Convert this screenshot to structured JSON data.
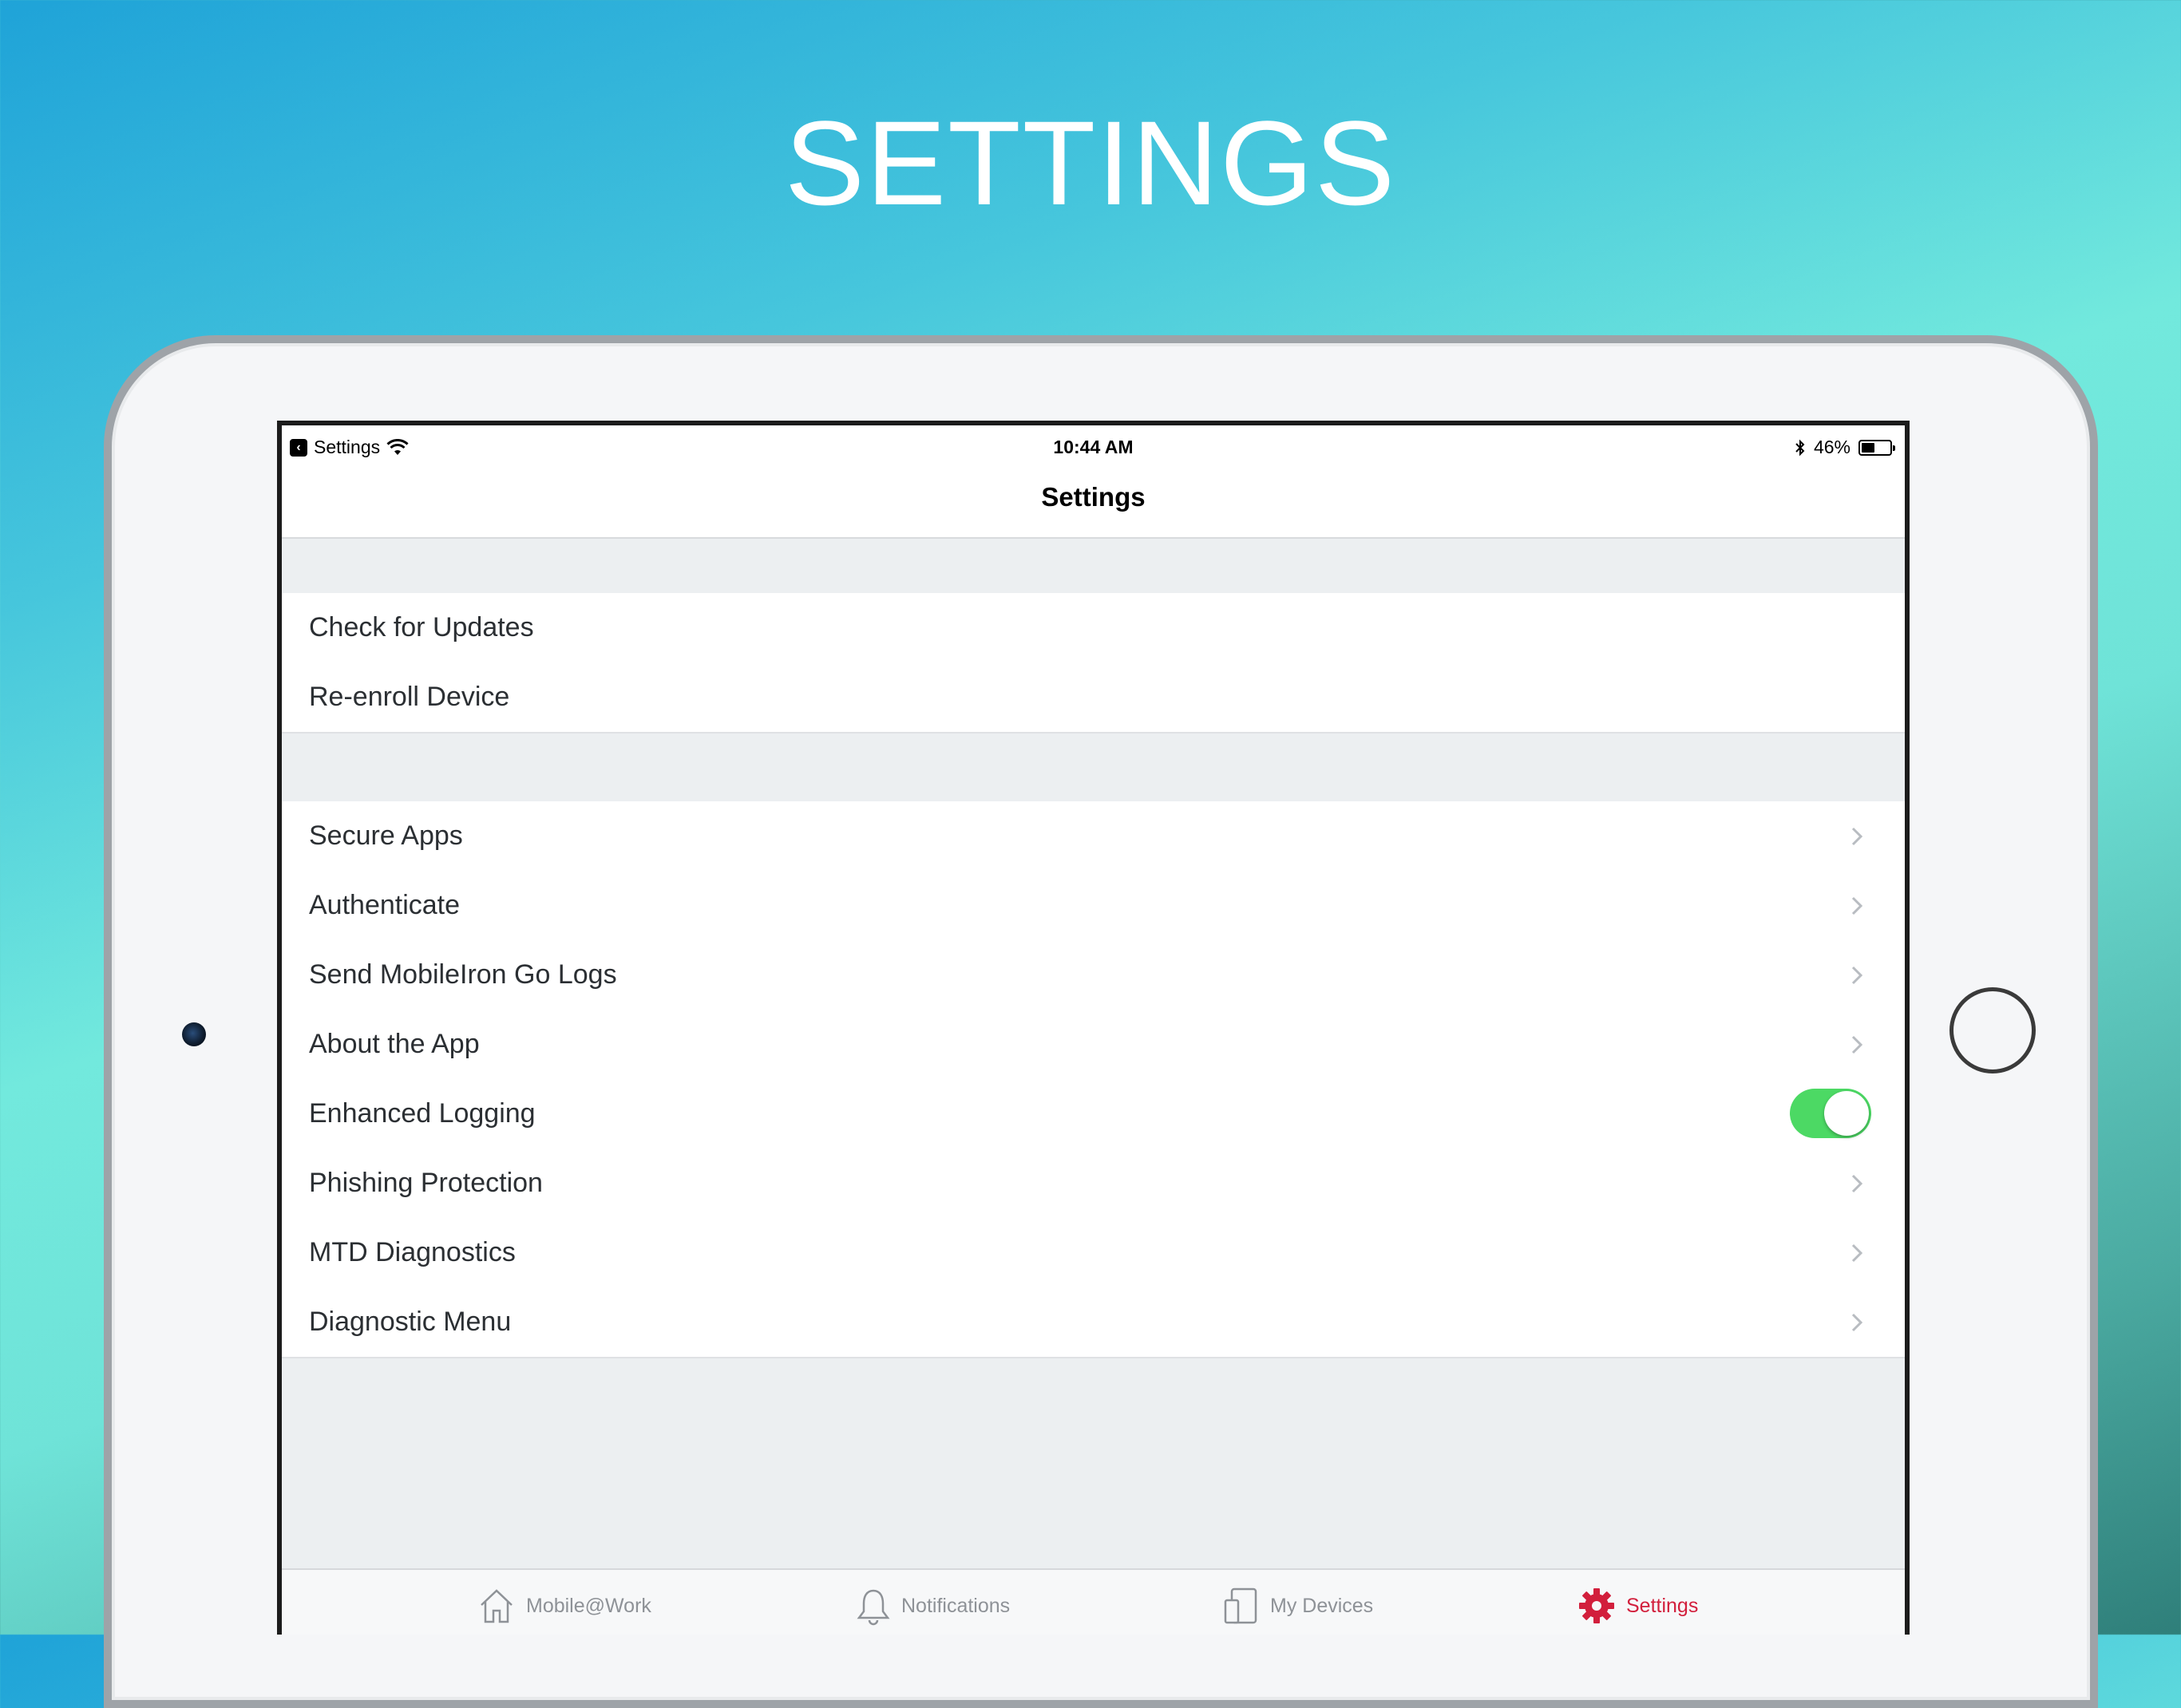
{
  "headline": "SETTINGS",
  "statusbar": {
    "back_app": "Settings",
    "time": "10:44 AM",
    "battery": "46%",
    "battery_level": 0.46,
    "wifi_icon": "wifi-icon",
    "bluetooth_icon": "bluetooth-icon"
  },
  "navbar": {
    "title": "Settings"
  },
  "sections": [
    {
      "rows": [
        {
          "label": "Check for Updates"
        },
        {
          "label": "Re-enroll Device"
        }
      ]
    },
    {
      "rows": [
        {
          "label": "Secure Apps",
          "accessory": "chevron-right-icon"
        },
        {
          "label": "Authenticate",
          "accessory": "chevron-right-icon"
        },
        {
          "label": "Send MobileIron Go Logs",
          "accessory": "chevron-right-icon"
        },
        {
          "label": "About the App",
          "accessory": "chevron-right-icon"
        },
        {
          "label": "Enhanced Logging",
          "accessory": "toggle",
          "toggle_on": true
        },
        {
          "label": "Phishing Protection",
          "accessory": "chevron-right-icon"
        },
        {
          "label": "MTD Diagnostics",
          "accessory": "chevron-right-icon"
        },
        {
          "label": "Diagnostic Menu",
          "accessory": "chevron-right-icon"
        }
      ]
    }
  ],
  "tabbar": {
    "tabs": [
      {
        "label": "Mobile@Work",
        "icon": "home-icon",
        "active": false
      },
      {
        "label": "Notifications",
        "icon": "bell-icon",
        "active": false
      },
      {
        "label": "My Devices",
        "icon": "devices-icon",
        "active": false
      },
      {
        "label": "Settings",
        "icon": "gear-icon",
        "active": true
      }
    ]
  },
  "colors": {
    "toggle_on": "#4cd964",
    "tab_active": "#d21f3c",
    "tab_inactive": "#8e9297"
  }
}
